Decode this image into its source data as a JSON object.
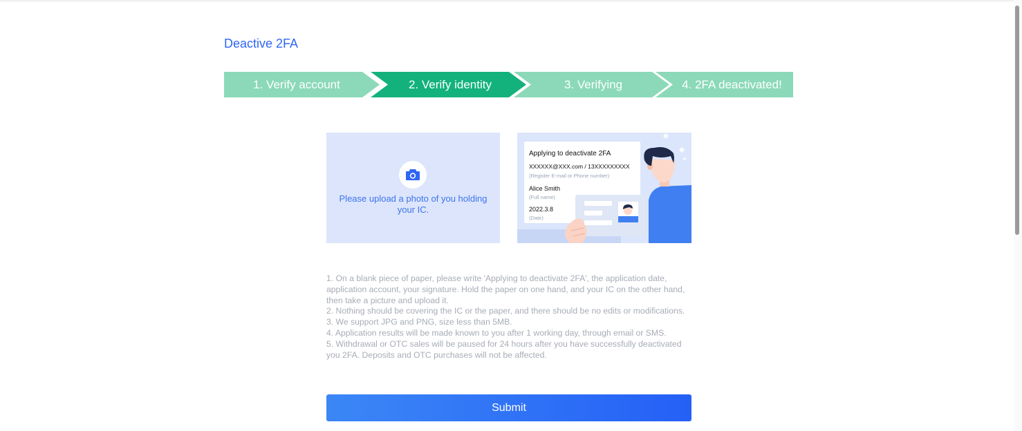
{
  "page": {
    "title": "Deactive 2FA"
  },
  "stepper": {
    "steps": [
      {
        "label": "1. Verify account",
        "state": "done",
        "color": "#8bd9b9"
      },
      {
        "label": "2. Verify identity",
        "state": "active",
        "color": "#13b27c"
      },
      {
        "label": "3. Verifying",
        "state": "pending",
        "color": "#8bd9b9"
      },
      {
        "label": "4. 2FA deactivated!",
        "state": "pending",
        "color": "#8bd9b9"
      }
    ]
  },
  "upload": {
    "icon": "camera-icon",
    "text": "Please upload a photo of you holding your IC."
  },
  "example": {
    "title": "Applying to deactivate 2FA",
    "account": "XXXXXX@XXX.com / 13XXXXXXXXX",
    "account_note": "(Register E-mail or Phone number)",
    "name": "Alice Smith",
    "name_note": "(Full name)",
    "date": "2022.3.8",
    "date_note": "(Date)"
  },
  "instructions": {
    "items": [
      "1. On a blank piece of paper, please write 'Applying to deactivate 2FA', the application date, application account, your signature. Hold the paper on one hand, and your IC on the other hand, then take a picture and upload it.",
      "2. Nothing should be covering the IC or the paper, and there should be no edits or modifications.",
      "3. We support JPG and PNG, size less than 5MB.",
      "4. Application results will be made known to you after 1 working day, through email or SMS.",
      "5. Withdrawal or OTC sales will be paused for 24 hours after you have successfully deactivated you 2FA. Deposits and OTC purchases will not be affected."
    ]
  },
  "actions": {
    "submit_label": "Submit"
  },
  "colors": {
    "accent": "#2f66f5",
    "step_active": "#13b27c",
    "step_inactive": "#8bd9b9",
    "upload_bg": "#dce5fb",
    "submit_start": "#3b87f6",
    "submit_end": "#2560f6",
    "instruction_text": "#a7acb5"
  }
}
